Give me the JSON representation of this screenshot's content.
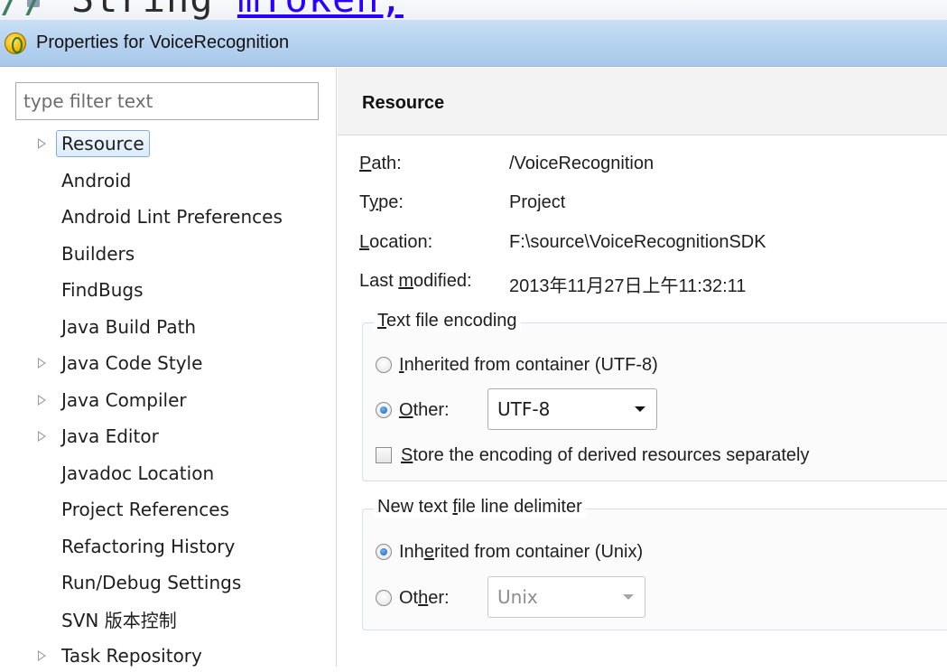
{
  "window": {
    "title": "Properties for VoiceRecognition"
  },
  "editor_peek": {
    "code_prefix": "// ",
    "code_text": "String ",
    "code_keyword": "mToken;"
  },
  "filter": {
    "placeholder": "type filter text"
  },
  "tree": [
    {
      "label": "Resource",
      "expandable": true,
      "selected": true
    },
    {
      "label": "Android",
      "expandable": false,
      "selected": false
    },
    {
      "label": "Android Lint Preferences",
      "expandable": false,
      "selected": false
    },
    {
      "label": "Builders",
      "expandable": false,
      "selected": false
    },
    {
      "label": "FindBugs",
      "expandable": false,
      "selected": false
    },
    {
      "label": "Java Build Path",
      "expandable": false,
      "selected": false
    },
    {
      "label": "Java Code Style",
      "expandable": true,
      "selected": false
    },
    {
      "label": "Java Compiler",
      "expandable": true,
      "selected": false
    },
    {
      "label": "Java Editor",
      "expandable": true,
      "selected": false
    },
    {
      "label": "Javadoc Location",
      "expandable": false,
      "selected": false
    },
    {
      "label": "Project References",
      "expandable": false,
      "selected": false
    },
    {
      "label": "Refactoring History",
      "expandable": false,
      "selected": false
    },
    {
      "label": "Run/Debug Settings",
      "expandable": false,
      "selected": false
    },
    {
      "label": "SVN 版本控制",
      "expandable": false,
      "selected": false
    },
    {
      "label": "Task Repository",
      "expandable": true,
      "selected": false
    }
  ],
  "page": {
    "header": "Resource",
    "info": {
      "path_label_mn": "P",
      "path_label_rest": "ath:",
      "path_value": "/VoiceRecognition",
      "type_label_pre": "T",
      "type_label_mn": "y",
      "type_label_rest": "pe:",
      "type_value": "Project",
      "location_label_mn": "L",
      "location_label_rest": "ocation:",
      "location_value": "F:\\source\\VoiceRecognitionSDK",
      "modified_label_pre": "Last ",
      "modified_label_mn": "m",
      "modified_label_rest": "odified:",
      "modified_value": "2013年11月27日上午11:32:11"
    },
    "encoding": {
      "title_mn": "T",
      "title_rest": "ext file encoding",
      "inherited_mn": "I",
      "inherited_rest": "nherited from container (UTF-8)",
      "other_mn": "O",
      "other_rest": "ther:",
      "other_value": "UTF-8",
      "store_mn": "S",
      "store_rest": "tore the encoding of derived resources separately"
    },
    "delimiter": {
      "title_pre": "New text ",
      "title_mn": "f",
      "title_rest": "ile line delimiter",
      "inherited_pre": "Inh",
      "inherited_mn": "e",
      "inherited_rest": "rited from container (Unix)",
      "other_pre": "Ot",
      "other_mn": "h",
      "other_rest": "er:",
      "other_value": "Unix"
    }
  }
}
